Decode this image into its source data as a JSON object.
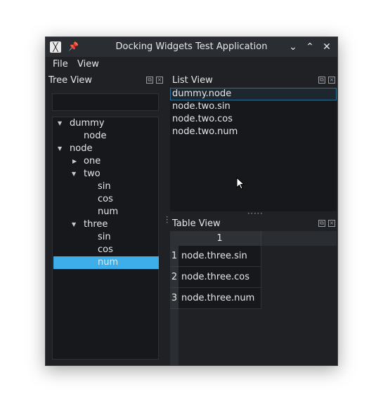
{
  "window": {
    "title": "Docking Widgets Test Application",
    "icons": {
      "app": "app-logo-icon",
      "pin": "pin-icon",
      "minimize": "chevron-down-icon",
      "maximize": "chevron-up-icon",
      "close": "close-icon"
    }
  },
  "menu": {
    "file": "File",
    "view": "View"
  },
  "tree_view": {
    "title": "Tree View",
    "filter_value": "",
    "items": [
      {
        "label": "dummy",
        "arrow": "▼"
      },
      {
        "label": "node",
        "arrow": ""
      },
      {
        "label": "node",
        "arrow": "▼"
      },
      {
        "label": "one",
        "arrow": "▶"
      },
      {
        "label": "two",
        "arrow": "▼"
      },
      {
        "label": "sin",
        "arrow": ""
      },
      {
        "label": "cos",
        "arrow": ""
      },
      {
        "label": "num",
        "arrow": ""
      },
      {
        "label": "three",
        "arrow": "▼"
      },
      {
        "label": "sin",
        "arrow": ""
      },
      {
        "label": "cos",
        "arrow": ""
      },
      {
        "label": "num",
        "arrow": ""
      }
    ],
    "selected_label": "num"
  },
  "list_view": {
    "title": "List View",
    "items": [
      "dummy.node",
      "node.two.sin",
      "node.two.cos",
      "node.two.num"
    ]
  },
  "table_view": {
    "title": "Table View",
    "column_header": "1",
    "row_headers": [
      "1",
      "2",
      "3"
    ],
    "cells": [
      "node.three.sin",
      "node.three.cos",
      "node.three.num"
    ]
  },
  "colors": {
    "selection": "#3daee9",
    "background": "#1f2125",
    "panel": "#16181b"
  }
}
